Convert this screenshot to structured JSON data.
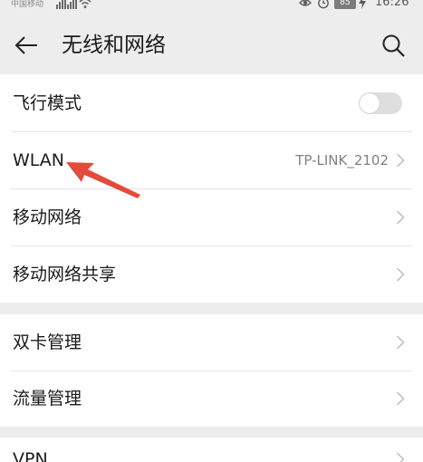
{
  "status_bar": {
    "carrier": "中国移动",
    "battery": "85",
    "time": "16:26",
    "icons": [
      "signal-icon",
      "wifi-icon",
      "eye-icon",
      "alarm-icon",
      "battery-icon",
      "charging-icon"
    ]
  },
  "header": {
    "title": "无线和网络",
    "back_icon": "back-arrow-icon",
    "search_icon": "search-icon"
  },
  "sections": [
    {
      "items": [
        {
          "label": "飞行模式",
          "control": "toggle",
          "toggle_on": false
        },
        {
          "label": "WLAN",
          "value": "TP-LINK_2102",
          "control": "chevron"
        },
        {
          "label": "移动网络",
          "control": "chevron"
        },
        {
          "label": "移动网络共享",
          "control": "chevron"
        }
      ]
    },
    {
      "items": [
        {
          "label": "双卡管理",
          "control": "chevron"
        },
        {
          "label": "流量管理",
          "control": "chevron"
        }
      ]
    },
    {
      "items": [
        {
          "label": "VPN",
          "control": "chevron"
        }
      ]
    }
  ],
  "annotation": {
    "type": "arrow",
    "points_to": "WLAN",
    "color": "#e64a3b"
  },
  "colors": {
    "background": "#ededed",
    "card": "#ffffff",
    "secondary_text": "#808080",
    "chevron": "#bdbdbd"
  }
}
